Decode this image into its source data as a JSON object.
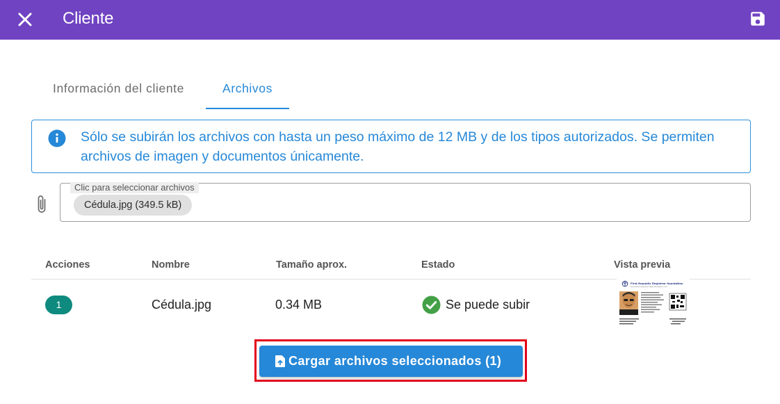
{
  "header": {
    "title": "Cliente",
    "close_icon": "close-icon",
    "save_icon": "save-icon",
    "background_color": "#7043c2"
  },
  "tabs": [
    {
      "label": "Información del cliente",
      "active": false
    },
    {
      "label": "Archivos",
      "active": true
    }
  ],
  "alert": {
    "icon": "info-icon",
    "text": "Sólo se subirán los archivos con hasta un peso máximo de 12 MB y de los tipos autorizados. Se permiten archivos de imagen y documentos únicamente."
  },
  "file_input": {
    "icon": "paperclip-icon",
    "label": "Clic para seleccionar archivos",
    "selected_files": [
      "Cédula.jpg (349.5 kB)"
    ]
  },
  "table": {
    "columns": [
      "Acciones",
      "Nombre",
      "Tamaño aprox.",
      "Estado",
      "Vista previa"
    ],
    "rows": [
      {
        "action": "1",
        "name": "Cédula.jpg",
        "size": "0.34 MB",
        "status": "Se puede subir",
        "status_icon": "check-circle-icon",
        "preview": {
          "header": "First Republic Registrar foundation",
          "subheader": "International Independent People Identification Card"
        }
      }
    ]
  },
  "upload_button": {
    "label": "Cargar archivos seleccionados (1)",
    "icon": "file-upload-icon"
  },
  "colors": {
    "accent": "#2688d8",
    "badge": "#0f8a7e",
    "success": "#43a047",
    "highlight": "#e2001a"
  }
}
